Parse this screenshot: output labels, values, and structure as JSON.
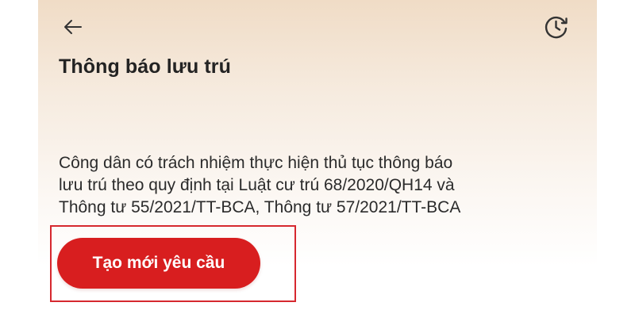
{
  "header": {
    "back_icon": "arrow-left-icon",
    "history_icon": "clock-history-icon",
    "title": "Thông báo lưu trú"
  },
  "content": {
    "description_lines": [
      "Công dân có trách nhiệm thực hiện thủ tục thông báo",
      "lưu trú theo quy định tại Luật cư trú 68/2020/QH14 và",
      "Thông tư 55/2021/TT-BCA, Thông tư 57/2021/TT-BCA"
    ]
  },
  "actions": {
    "create_request_label": "Tạo mới yêu cầu"
  },
  "colors": {
    "primary_red": "#d81e1f",
    "highlight_border": "#d6282f",
    "text_dark": "#232323"
  }
}
